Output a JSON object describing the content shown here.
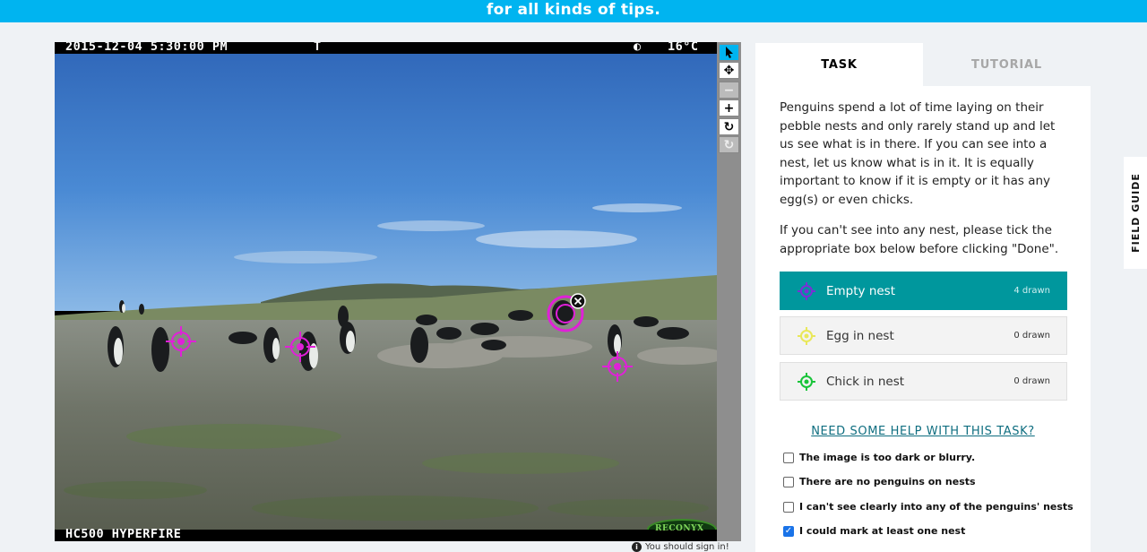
{
  "banner": {
    "text": "for all kinds of tips."
  },
  "subject": {
    "timestamp": "2015-12-04 5:30:00 PM",
    "camera_flag": "T",
    "moon_icon": "moon-phase-icon",
    "temperature": "16°C",
    "camera_model": "HC500 HYPERFIRE",
    "brand_logo": "RECONYX"
  },
  "toolbar": {
    "items": [
      {
        "name": "annotate-pointer-icon",
        "glyph": "➤"
      },
      {
        "name": "move-icon",
        "glyph": "✥"
      },
      {
        "name": "zoom-out-icon",
        "glyph": "−"
      },
      {
        "name": "zoom-in-icon",
        "glyph": "+"
      },
      {
        "name": "rotate-icon",
        "glyph": "↻"
      },
      {
        "name": "reset-icon",
        "glyph": "↺"
      }
    ]
  },
  "signin": {
    "text": "You should sign in!"
  },
  "task": {
    "tabs": [
      {
        "label": "TASK"
      },
      {
        "label": "TUTORIAL"
      }
    ],
    "instructions": [
      "Penguins spend a lot of time laying on their pebble nests and only rarely stand up and let us see what is in there. If you can see into a nest, let us know what is in it. It is equally important to know if it is empty or it has any egg(s) or even chicks.",
      "If you can't see into any nest, please tick the appropriate box below before clicking \"Done\"."
    ],
    "tools": [
      {
        "label": "Empty nest",
        "count": "4 drawn",
        "color": "#7b2fd6"
      },
      {
        "label": "Egg in nest",
        "count": "0 drawn",
        "color": "#e9e85a"
      },
      {
        "label": "Chick in nest",
        "count": "0 drawn",
        "color": "#19c43a"
      }
    ],
    "help_link": "NEED SOME HELP WITH THIS TASK?",
    "checkboxes": [
      {
        "label": "The image is too dark or blurry.",
        "checked": false
      },
      {
        "label": "There are no penguins on nests",
        "checked": false
      },
      {
        "label": "I can't see clearly into any of the penguins' nests",
        "checked": false
      },
      {
        "label": "I could mark at least one nest",
        "checked": true
      }
    ]
  },
  "field_guide": {
    "label": "FIELD GUIDE"
  },
  "colors": {
    "accent": "#00b4f0",
    "selected_tool": "#00979d",
    "marker": "#e020d8"
  }
}
